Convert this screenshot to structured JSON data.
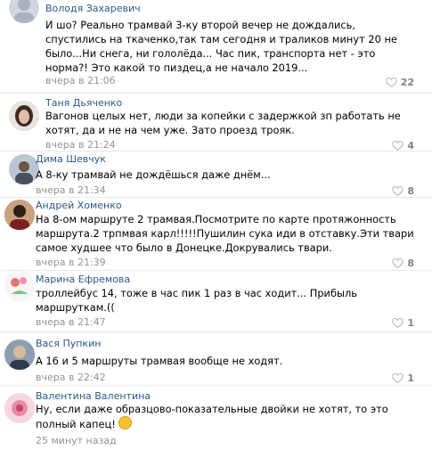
{
  "comments": [
    {
      "author": "Володя Захаревич",
      "text": "И шо? Реально трамвай 3-ку второй вечер не дождались, спустились на ткаченко,так там сегодня и траликов минут 20 не было...Ни снега, ни гололёда... Час пик, транспорта нет - это норма?! Это какой то пиздец,а не начало 2019...",
      "date": "вчера в 21:06",
      "likes": "22"
    },
    {
      "author": "Таня Дьяченко",
      "text": "Вагонов целых нет, люди за копейки с задержкой зп работать не хотят, да и не на чем уже. Зато проезд трояк.",
      "date": "вчера в 21:24",
      "likes": "4"
    },
    {
      "author": "Дима Шевчук",
      "text": "А 8-ку трамвай не дождёшься даже днём...",
      "date": "вчера в 21:34",
      "likes": "8"
    },
    {
      "author": "Андрей Хоменко",
      "text": "На 8-ом маршруте 2 трамвая.Посмотрите по карте протяжонность маршрута.2 трпмвая карл!!!!!Пушилин сука иди в отставку.Эти твари самое худшее что было в Донецке.Докрувались твари.",
      "date": "вчера в 21:39",
      "likes": "8"
    },
    {
      "author": "Марина Ефремова",
      "text": "троллейбус 14, тоже в час пик 1 раз в час ходит... Прибыль маршруткам.((",
      "date": "вчера в 21:47",
      "likes": "1"
    },
    {
      "author": "Вася Пупкин",
      "text": "А 16 и 5 маршруты трамвая вообще не ходят.",
      "date": "вчера в 22:42",
      "likes": "1"
    },
    {
      "author": "Валентина Валентина",
      "text": "Ну, если даже образцово-показательные двойки не хотят, то это полный капец!",
      "date": "25 минут назад",
      "likes": ""
    }
  ],
  "icons": {
    "like": "heart-icon",
    "emoji": "relieved-face-emoji-icon"
  },
  "colors": {
    "author": "#2a5885",
    "meta": "#939393",
    "like_count": "#828282",
    "separator": "#e7e8ec"
  }
}
